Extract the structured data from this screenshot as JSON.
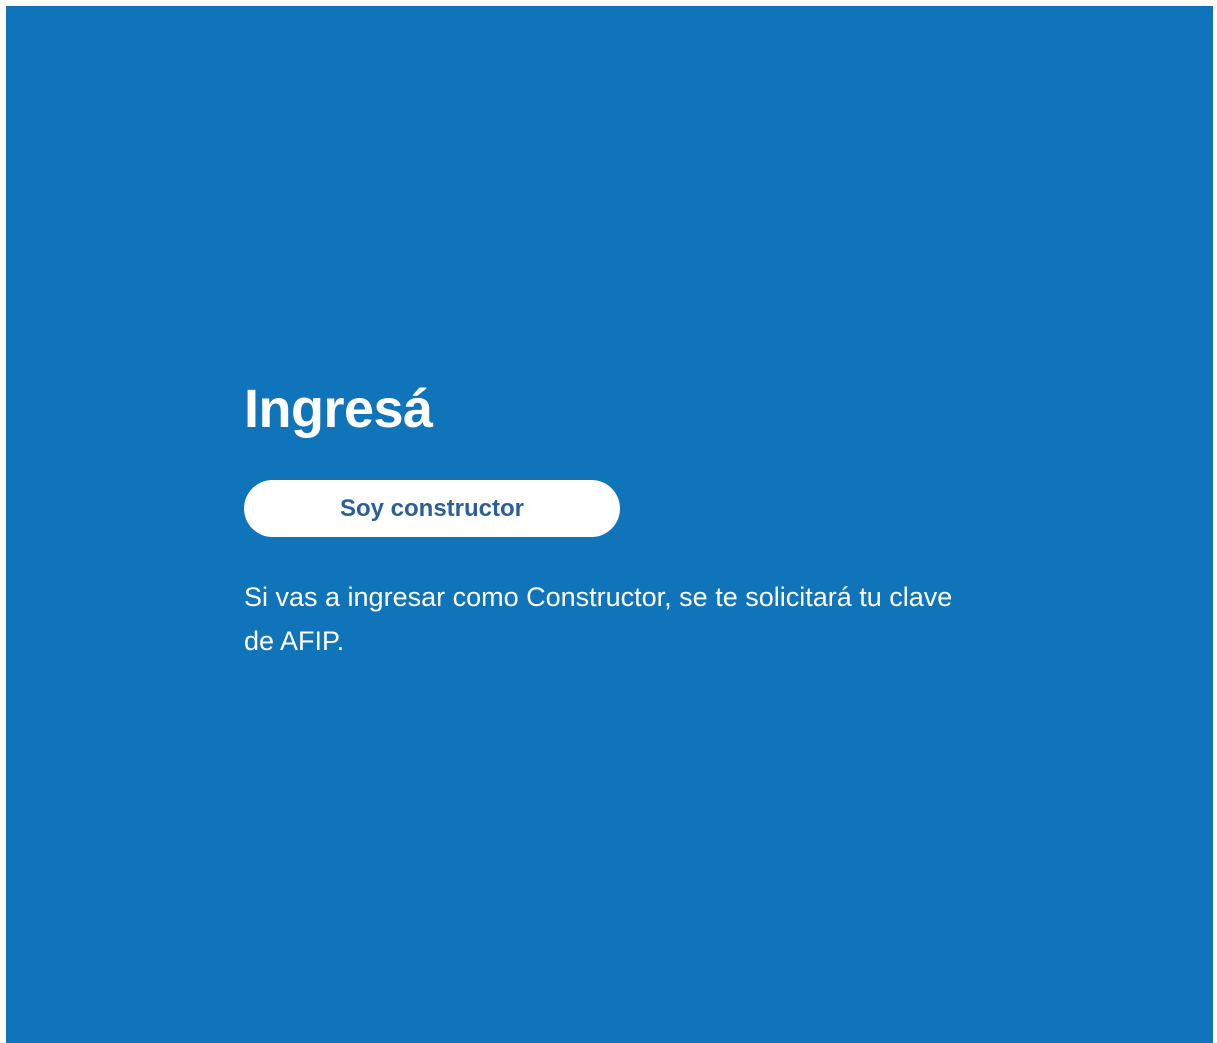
{
  "login": {
    "title": "Ingresá",
    "button_label": "Soy constructor",
    "note": "Si vas a ingresar como Constructor, se te solicitará tu clave de AFIP."
  },
  "colors": {
    "background": "#0f74ba",
    "button_background": "#ffffff",
    "button_text": "#2b5f96",
    "text": "#ffffff"
  }
}
